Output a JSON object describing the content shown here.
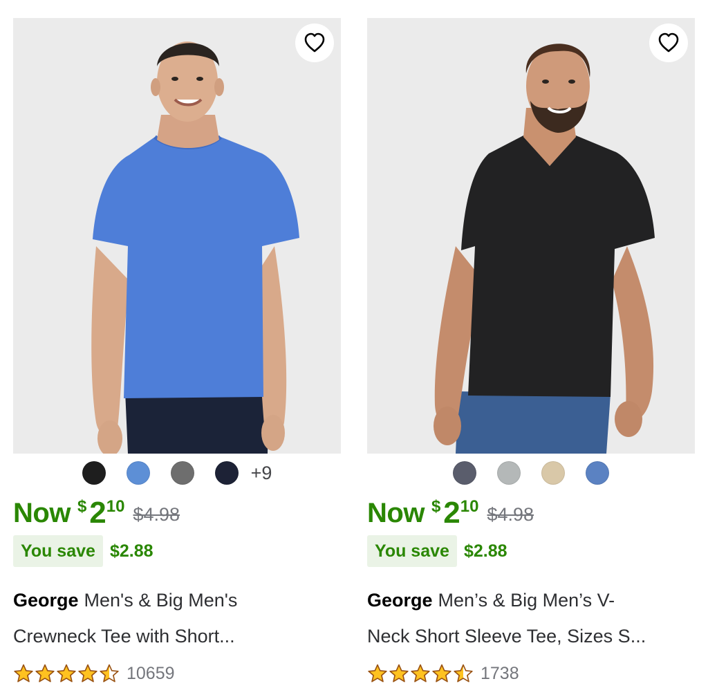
{
  "products": [
    {
      "favorite_icon": "heart-outline-icon",
      "swatches": [
        "#1e1e1e",
        "#5d8fd6",
        "#6e6e6e",
        "#1d2236"
      ],
      "more_colors": "+9",
      "price": {
        "now_label": "Now",
        "currency": "$",
        "dollars": "2",
        "cents": "10",
        "was": "$4.98"
      },
      "savings": {
        "label": "You save",
        "amount": "$2.88"
      },
      "brand": "George",
      "title_line1": "Men's & Big Men's",
      "title_line2": "Crewneck Tee with Short...",
      "rating": 4.5,
      "review_count": "10659",
      "shirt_color": "#4e7ed8"
    },
    {
      "favorite_icon": "heart-outline-icon",
      "swatches": [
        "#5a5d6c",
        "#b4b8b8",
        "#d9c8a8",
        "#5b82c2"
      ],
      "more_colors": "",
      "price": {
        "now_label": "Now",
        "currency": "$",
        "dollars": "2",
        "cents": "10",
        "was": "$4.98"
      },
      "savings": {
        "label": "You save",
        "amount": "$2.88"
      },
      "brand": "George",
      "title_line1": "Men’s & Big Men’s V-",
      "title_line2": "Neck Short Sleeve Tee, Sizes S...",
      "rating": 4.5,
      "review_count": "1738",
      "shirt_color": "#222223"
    }
  ],
  "colors": {
    "accent_green": "#2a8703",
    "save_bg": "#eaf3e6",
    "star": "#ffc220"
  }
}
